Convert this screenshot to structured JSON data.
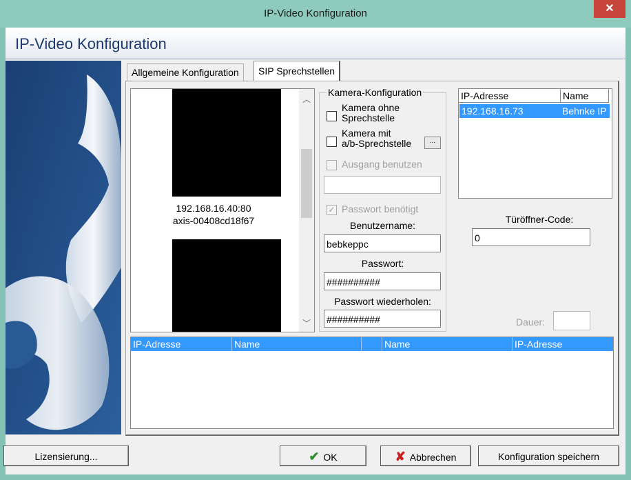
{
  "window": {
    "title": "IP-Video Konfiguration",
    "close_glyph": "✕"
  },
  "header": {
    "title": "IP-Video Konfiguration"
  },
  "tabs": [
    {
      "label": "Allgemeine Konfiguration",
      "active": false
    },
    {
      "label": "SIP Sprechstellen",
      "active": true
    }
  ],
  "cameras": [
    {
      "ip": "192.168.16.40:80",
      "name": "axis-00408cd18f67"
    }
  ],
  "camera_config": {
    "legend": "Kamera-Konfiguration",
    "cb_no_station": {
      "label_line1": "Kamera ohne",
      "label_line2": "Sprechstelle",
      "checked": false
    },
    "cb_ab_station": {
      "label_line1": "Kamera mit",
      "label_line2": "a/b-Sprechstelle",
      "checked": false
    },
    "browse_label": "...",
    "cb_output": {
      "label": "Ausgang benutzen",
      "checked": false,
      "enabled": false
    },
    "output_value": "",
    "cb_password": {
      "label": "Passwort benötigt",
      "checked": true,
      "enabled": false
    },
    "username_label": "Benutzername:",
    "username_value": "bebkeppc",
    "password_label": "Passwort:",
    "password_value": "##########",
    "password_repeat_label": "Passwort wiederholen:",
    "password_repeat_value": "##########"
  },
  "sip_list": {
    "columns": [
      "IP-Adresse",
      "Name"
    ],
    "rows": [
      {
        "ip": "192.168.16.73",
        "name": "Behnke IP"
      }
    ]
  },
  "door_code": {
    "label": "Türöffner-Code:",
    "value": "0"
  },
  "duration": {
    "label": "Dauer:",
    "value": ""
  },
  "bottom_list": {
    "columns": [
      "IP-Adresse",
      "Name",
      "",
      "Name",
      "IP-Adresse"
    ]
  },
  "footer": {
    "license_label": "Lizensierung...",
    "ok_label": "OK",
    "cancel_label": "Abbrechen",
    "save_label": "Konfiguration speichern"
  },
  "colors": {
    "title_bar": "#8ecbbd",
    "close_button": "#c7453a",
    "selection": "#3399ff",
    "header_text": "#1b3a6e"
  }
}
